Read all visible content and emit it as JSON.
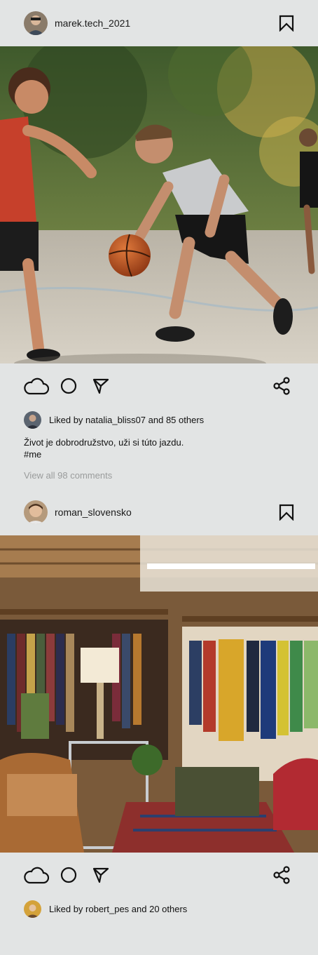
{
  "posts": [
    {
      "username": "marek.tech_2021",
      "image_alt": "Boys playing basketball on an outdoor court",
      "likes_text": "Liked by natalia_bliss07 and 85 others",
      "caption_line1": "Život je dobrodružstvo, uži si túto jazdu.",
      "caption_line2": "#me",
      "view_comments": "View all 98 comments"
    },
    {
      "username": "roman_slovensko",
      "image_alt": "Cluttered thrift shop with racks of clothes",
      "likes_text": "Liked by robert_pes and 20 others"
    }
  ],
  "icons": {
    "bookmark": "bookmark-icon",
    "like": "cloud-like-icon",
    "comment": "circle-comment-icon",
    "send": "send-icon",
    "share": "share-icon"
  },
  "colors": {
    "background": "#e2e4e4",
    "muted_text": "#9a9c9c"
  }
}
